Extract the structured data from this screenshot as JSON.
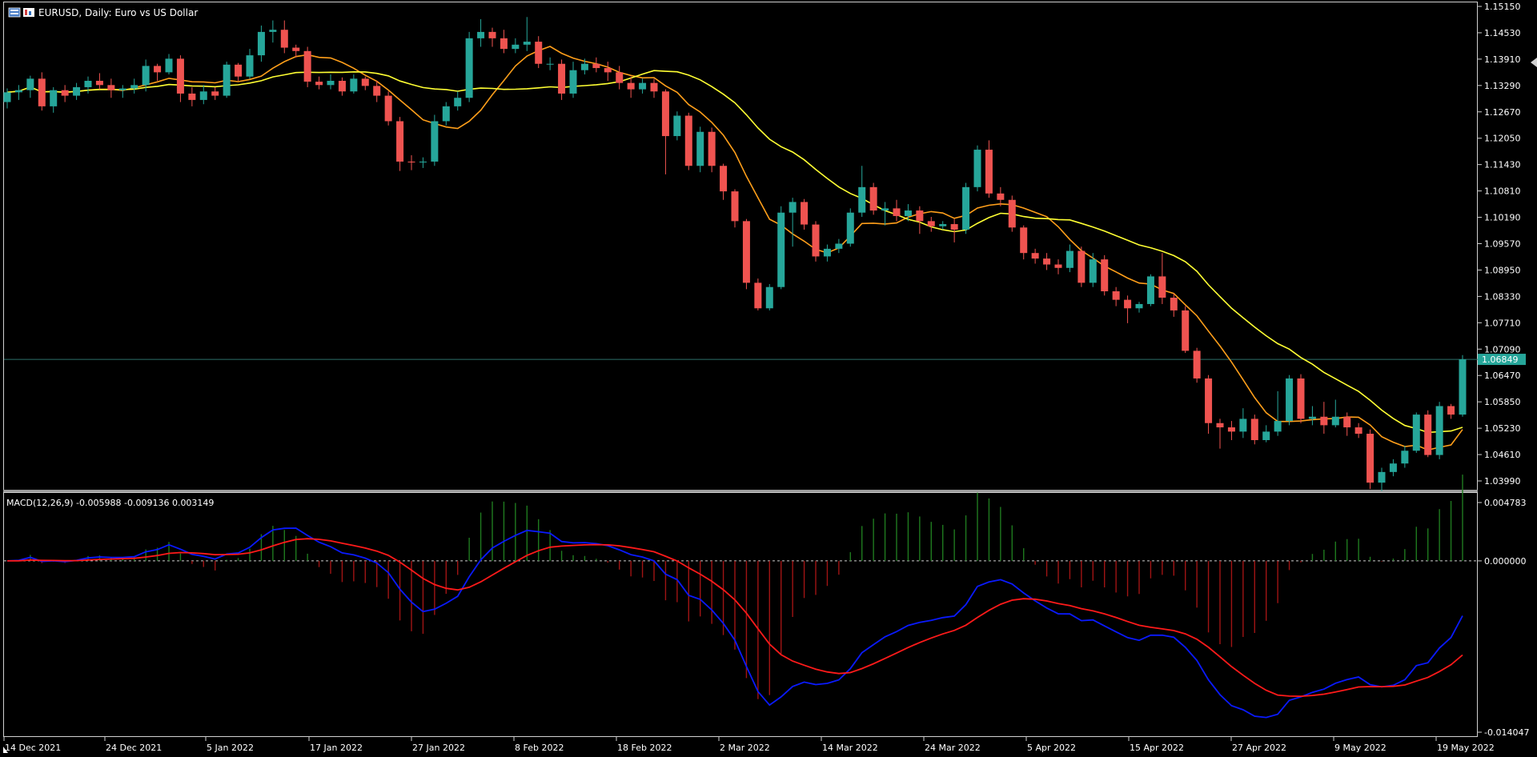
{
  "header": {
    "symbol": "EURUSD",
    "timeframe": "Daily",
    "description": "Euro vs US Dollar",
    "title": "EURUSD, Daily:  Euro vs US Dollar"
  },
  "price_axis": {
    "ticks": [
      "1.15150",
      "1.14530",
      "1.13910",
      "1.13290",
      "1.12670",
      "1.12050",
      "1.11430",
      "1.10810",
      "1.10190",
      "1.09570",
      "1.08950",
      "1.08330",
      "1.07710",
      "1.07090",
      "1.06470",
      "1.05850",
      "1.05230",
      "1.04610",
      "1.03990"
    ],
    "current_price": "1.06849"
  },
  "macd": {
    "label": "MACD(12,26,9) -0.005988 -0.009136 0.003149",
    "ticks": [
      "0.004783",
      "0.000000",
      "-0.014047"
    ]
  },
  "time_axis": {
    "labels": [
      "14 Dec 2021",
      "24 Dec 2021",
      "5 Jan 2022",
      "17 Jan 2022",
      "27 Jan 2022",
      "8 Feb 2022",
      "18 Feb 2022",
      "2 Mar 2022",
      "14 Mar 2022",
      "24 Mar 2022",
      "5 Apr 2022",
      "15 Apr 2022",
      "27 Apr 2022",
      "9 May 2022",
      "19 May 2022"
    ]
  },
  "colors": {
    "background": "#000000",
    "bull": "#26a69a",
    "bear": "#ef5350",
    "ma_fast": "#ff9f1a",
    "ma_slow": "#ffff33",
    "macd_line": "#0a1aff",
    "signal_line": "#ff1a1a",
    "hist_pos": "#1f7a1f",
    "hist_neg": "#a01414",
    "grid_text": "#ffffff",
    "price_line": "#2e6f6a"
  },
  "chart_data": {
    "type": "candlestick",
    "symbol": "EURUSD",
    "period": "Daily",
    "date_range": [
      "14 Dec 2021",
      "20 May 2022"
    ],
    "ylim": [
      1.0368,
      1.153
    ],
    "last_close": 1.06849,
    "indicators": [
      "moving average (fast)",
      "moving average (slow)",
      "MACD(12,26,9)"
    ],
    "macd": {
      "macd": -0.005988,
      "signal": -0.009136,
      "histogram": 0.003149,
      "ylim": [
        -0.014047,
        0.004783
      ]
    }
  }
}
